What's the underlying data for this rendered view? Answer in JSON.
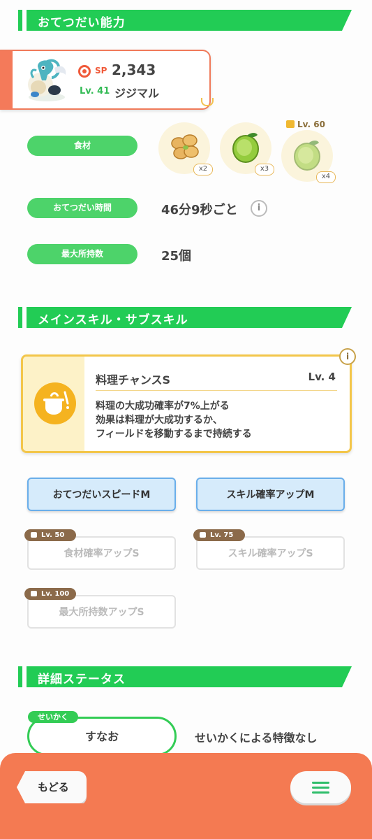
{
  "sections": {
    "helping_ability": "おてつだい能力",
    "skills": "メインスキル・サブスキル",
    "detailed_status": "詳細ステータス"
  },
  "pokemon": {
    "sp_label": "SP",
    "sp_value": "2,343",
    "level": "Lv. 41",
    "name": "ジジマル"
  },
  "info": {
    "ingredients_label": "食材",
    "ingredients": [
      {
        "qty": "x2",
        "locked": false
      },
      {
        "qty": "x3",
        "locked": false
      },
      {
        "qty": "x4",
        "locked": true,
        "unlock_level": "Lv. 60"
      }
    ],
    "helping_time_label": "おてつだい時間",
    "helping_time_value": "46分9秒ごと",
    "max_carry_label": "最大所持数",
    "max_carry_value": "25個"
  },
  "main_skill": {
    "name": "料理チャンスS",
    "level": "Lv. 4",
    "desc_line1": "料理の大成功確率が7%上がる",
    "desc_line2": "効果は料理が大成功するか、",
    "desc_line3": "フィールドを移動するまで持続する"
  },
  "sub_skills": [
    {
      "label": "おてつだいスピードM",
      "locked": false
    },
    {
      "label": "スキル確率アップM",
      "locked": false
    },
    {
      "label": "食材確率アップS",
      "locked": true,
      "unlock_level": "Lv. 50"
    },
    {
      "label": "スキル確率アップS",
      "locked": true,
      "unlock_level": "Lv. 75"
    },
    {
      "label": "最大所持数アップS",
      "locked": true,
      "unlock_level": "Lv. 100"
    }
  ],
  "nature": {
    "tag": "せいかく",
    "value": "すなお",
    "description": "せいかくによる特徴なし"
  },
  "bottom": {
    "back_label": "もどる"
  },
  "colors": {
    "section_green": "#22cc55",
    "pill_green": "#4dd36a",
    "accent_orange": "#f47a52",
    "skill_yellow": "#f3c64a",
    "subskill_blue": "#6aaeea"
  }
}
